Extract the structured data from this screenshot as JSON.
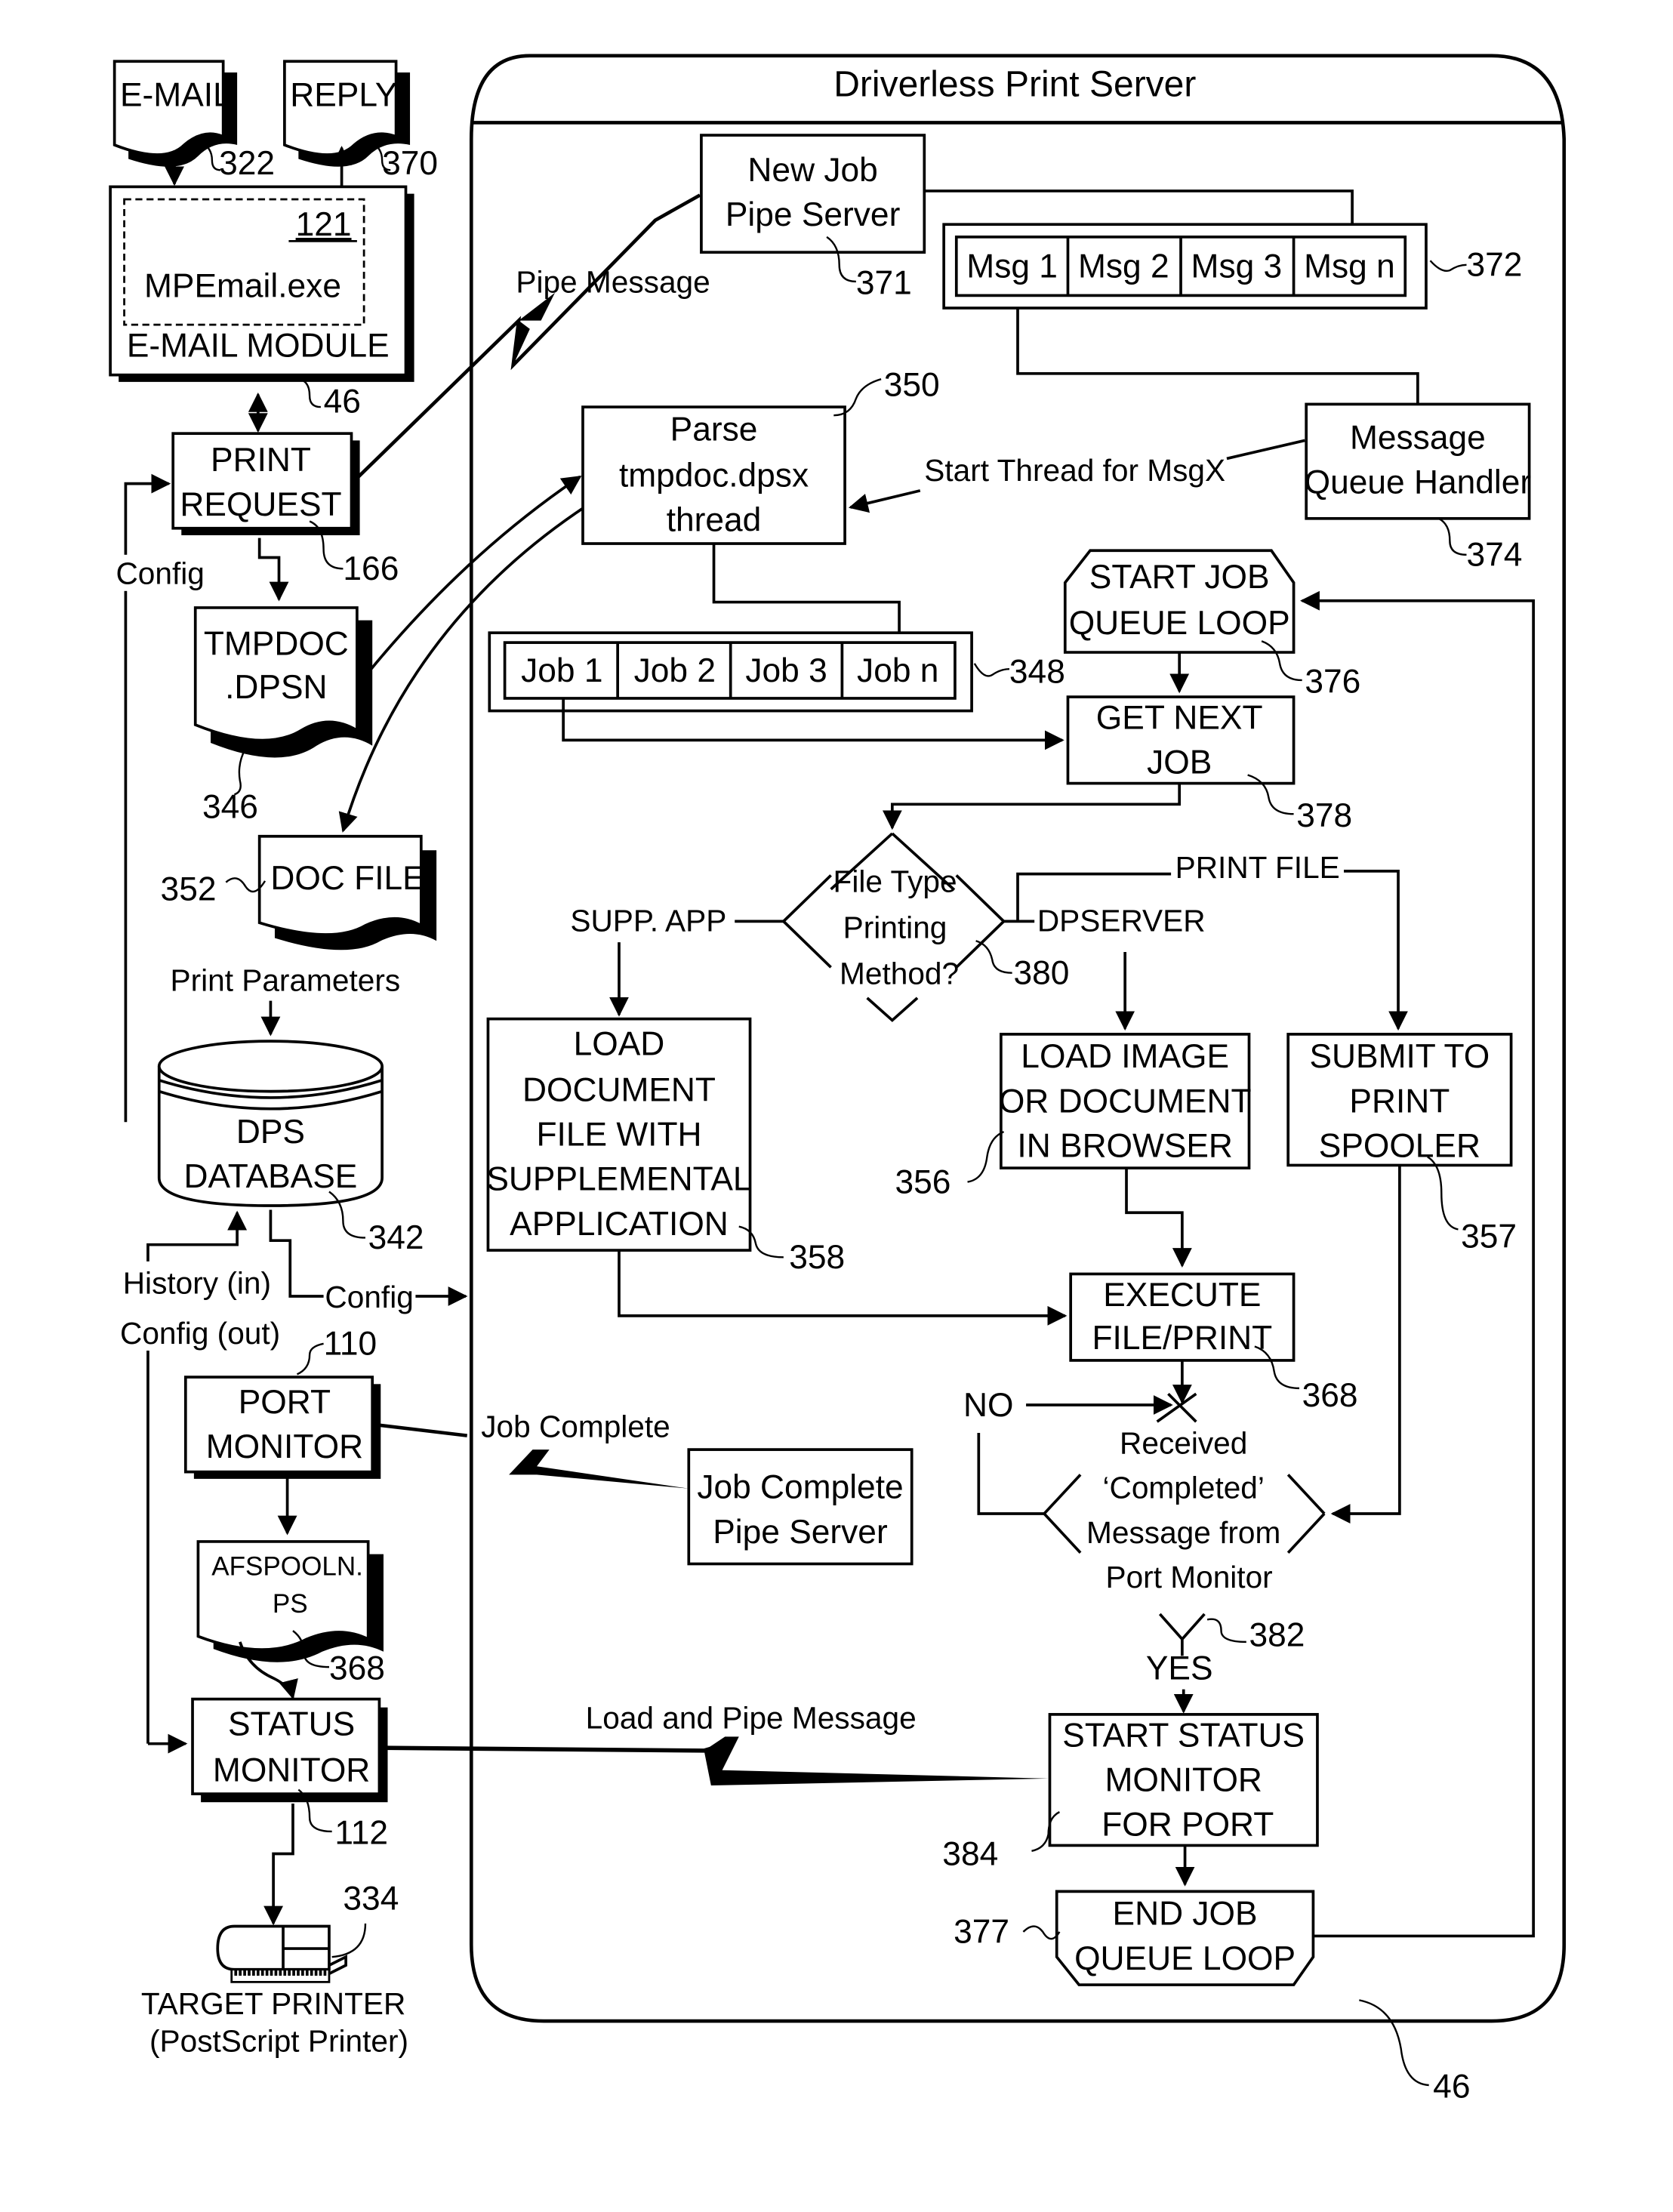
{
  "title": "Driverless Print Server",
  "colors": {
    "ink": "#000000",
    "paper": "#ffffff"
  },
  "left": {
    "email_doc": {
      "label": "E-MAIL",
      "ref": "322"
    },
    "reply_doc": {
      "label": "REPLY",
      "ref": "370"
    },
    "email_module": {
      "inner_ref": "121",
      "inner_label": "MPEmail.exe",
      "label": "E-MAIL MODULE",
      "ref": "46"
    },
    "print_request": {
      "line1": "PRINT",
      "line2": "REQUEST",
      "ref": "166"
    },
    "config_label": "Config",
    "tmpdoc": {
      "line1": "TMPDOC",
      "line2": ".DPSN",
      "ref": "346"
    },
    "doc_file": {
      "label": "DOC FILE",
      "ref": "352"
    },
    "print_parameters": "Print Parameters",
    "dps_database": {
      "line1": "DPS",
      "line2": "DATABASE",
      "ref": "342"
    },
    "history_in": "History (in)",
    "config_out": "Config (out)",
    "config_arrow": "Config",
    "port_monitor": {
      "line1": "PORT",
      "line2": "MONITOR",
      "ref": "110"
    },
    "afspool": {
      "line1": "AFSPOOLN.",
      "line2": "PS",
      "ref": "368"
    },
    "status_monitor": {
      "line1": "STATUS",
      "line2": "MONITOR",
      "ref": "112"
    },
    "printer": {
      "ref": "334",
      "line1": "TARGET PRINTER",
      "line2": "(PostScript Printer)",
      "icon": "printer-icon"
    }
  },
  "links": {
    "pipe_message": "Pipe Message",
    "start_thread": "Start Thread for MsgX",
    "job_complete": "Job Complete",
    "load_and_pipe": "Load and Pipe Message"
  },
  "server": {
    "new_job_pipe": {
      "line1": "New Job",
      "line2": "Pipe Server",
      "ref": "371"
    },
    "msg_queue": {
      "items": [
        "Msg 1",
        "Msg 2",
        "Msg 3",
        "Msg n"
      ],
      "ref": "372"
    },
    "parse_thread": {
      "line1": "Parse",
      "line2": "tmpdoc.dpsx",
      "line3": "thread",
      "ref": "350"
    },
    "queue_handler": {
      "line1": "Message",
      "line2": "Queue Handler",
      "ref": "374"
    },
    "job_queue": {
      "items": [
        "Job 1",
        "Job 2",
        "Job 3",
        "Job n"
      ],
      "ref": "348"
    },
    "start_loop": {
      "line1": "START JOB",
      "line2": "QUEUE LOOP",
      "ref": "376"
    },
    "get_next": {
      "line1": "GET NEXT",
      "line2": "JOB",
      "ref": "378"
    },
    "decision": {
      "line1": "File Type",
      "line2": "Printing",
      "line3": "Method?",
      "ref": "380",
      "supp_app": "SUPP. APP",
      "dpserver": "DPSERVER",
      "print_file": "PRINT FILE"
    },
    "load_supp": {
      "lines": [
        "LOAD",
        "DOCUMENT",
        "FILE WITH",
        "SUPPLEMENTAL",
        "APPLICATION"
      ],
      "ref": "358"
    },
    "load_browser": {
      "lines": [
        "LOAD IMAGE",
        "OR DOCUMENT",
        "IN BROWSER"
      ],
      "ref": "356"
    },
    "submit_spooler": {
      "lines": [
        "SUBMIT TO",
        "PRINT",
        "SPOOLER"
      ],
      "ref": "357"
    },
    "execute": {
      "line1": "EXECUTE",
      "line2": "FILE/PRINT",
      "ref": "368"
    },
    "received": {
      "lines": [
        "Received",
        "‘Completed’",
        "Message from",
        "Port Monitor"
      ],
      "ref": "382",
      "no": "NO",
      "yes": "YES"
    },
    "job_complete_pipe": {
      "line1": "Job Complete",
      "line2": "Pipe Server"
    },
    "start_status": {
      "lines": [
        "START STATUS",
        "MONITOR",
        "FOR PORT"
      ],
      "ref": "384"
    },
    "end_loop": {
      "line1": "END JOB",
      "line2": "QUEUE LOOP",
      "ref": "377"
    },
    "ref": "46"
  }
}
